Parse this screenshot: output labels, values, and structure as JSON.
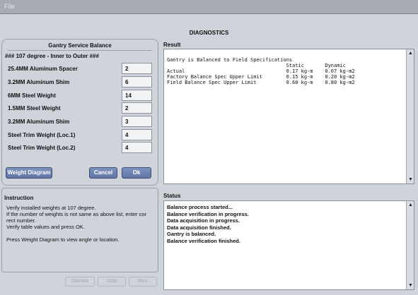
{
  "window": {
    "menu": "File"
  },
  "heading": "DIAGNOSTICS",
  "balance": {
    "title": "Gantry Service Balance",
    "subtitle": "### 107 degree - Inner to Outer ###",
    "rows": [
      {
        "label": "25.4MM Aluminum Spacer",
        "value": "2"
      },
      {
        "label": "3.2MM Aluminum Shim",
        "value": "6"
      },
      {
        "label": "6MM Steel Weight",
        "value": "14"
      },
      {
        "label": "1.5MM Steel Weight",
        "value": "2"
      },
      {
        "label": "3.2MM Aluminum Shim",
        "value": "3"
      },
      {
        "label": "Steel Trim Weight (Loc.1)",
        "value": "4"
      },
      {
        "label": "Steel Trim Weight (Loc.2)",
        "value": "4"
      }
    ],
    "buttons": {
      "weight_diagram": "Weight Diagram",
      "cancel": "Cancel",
      "ok": "Ok"
    }
  },
  "instruction": {
    "label": "Instruction",
    "text": "Verify installed weights at 107 degree.\nIf the number of weights is not same as above list, enter cor\nrect number.\nVerify table values and press OK.\n\nPress Weight Diagram to view angle or location."
  },
  "result": {
    "label": "Result",
    "text": "Gantry is Balanced to Field Specifications\n                                        Static       Dynamic\nActual                                  0.17 kg-m    0.07 kg-m2\nFactory Balance Spec Upper Limit        0.15 kg-m    0.20 kg-m2\nField Balance Spec Upper Limit          0.60 kg-m    0.80 kg-m2"
  },
  "status": {
    "label": "Status",
    "text": "Balance process started...\nBalance verification in progress.\nData acquisition in progress.\nData acquisition finished.\nGantry is balanced.\nBalance verification finished."
  },
  "bottom_buttons": [
    "Dismiss",
    "Stop",
    "Run"
  ]
}
